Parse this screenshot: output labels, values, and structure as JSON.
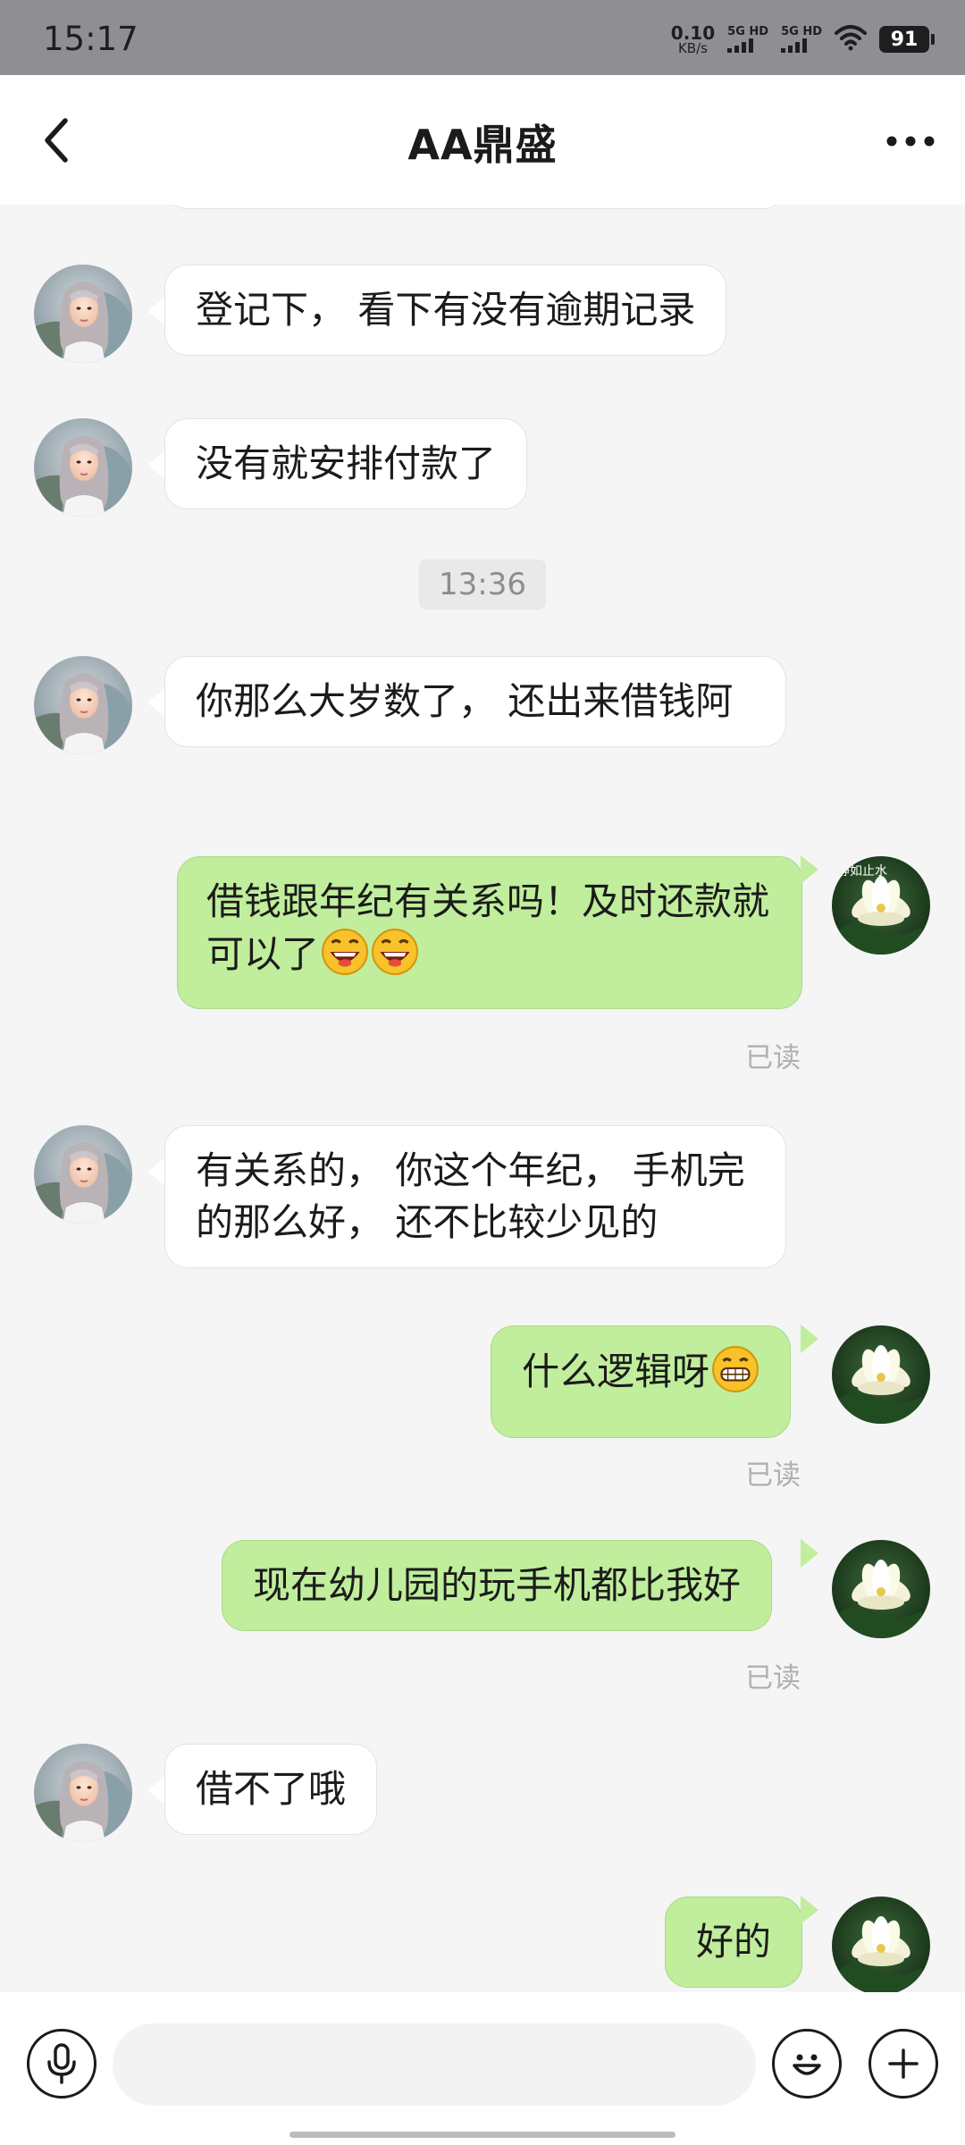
{
  "status_bar": {
    "time": "15:17",
    "net_speed_value": "0.10",
    "net_speed_unit": "KB/s",
    "sim1_label": "5G HD",
    "sim2_label": "5G HD",
    "battery": "91"
  },
  "header": {
    "title": "AA鼎盛",
    "back_icon": "chevron-left-icon",
    "more_icon": "more-horizontal-icon"
  },
  "messages": [
    {
      "side": "in",
      "text": "登记下， 看下有没有逾期记录"
    },
    {
      "side": "in",
      "text": "没有就安排付款了"
    },
    {
      "side": "in",
      "text": "你那么大岁数了， 还出来借钱阿"
    },
    {
      "side": "out",
      "text": "借钱跟年纪有关系吗！及时还款就可以了",
      "emoji": "laughing-emoji x2",
      "status": "已读"
    },
    {
      "side": "in",
      "text": "有关系的， 你这个年纪， 手机完的那么好， 还不比较少见的"
    },
    {
      "side": "out",
      "text": "什么逻辑呀",
      "emoji": "grinning-emoji",
      "status": "已读"
    },
    {
      "side": "out",
      "text": "现在幼儿园的玩手机都比我好",
      "status": "已读"
    },
    {
      "side": "in",
      "text": "借不了哦"
    },
    {
      "side": "out",
      "text": "好的"
    }
  ],
  "timestamp_divider": "13:36",
  "my_avatar_caption": "静如止水",
  "input_bar": {
    "placeholder": "",
    "voice_icon": "microphone-icon",
    "emoji_icon": "smiley-icon",
    "plus_icon": "plus-icon"
  },
  "colors": {
    "status_bar_bg": "#8f8f93",
    "chat_bg": "#f5f5f5",
    "outgoing_bubble": "#c0ee9c",
    "incoming_bubble": "#ffffff",
    "read_text": "#b0b0b0"
  }
}
